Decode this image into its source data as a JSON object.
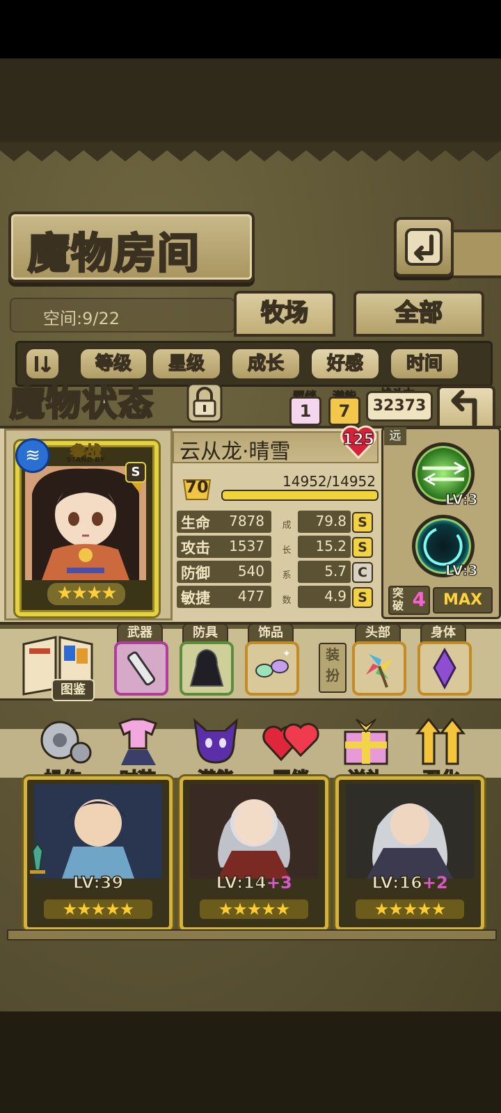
{
  "header": {
    "title": "魔物房间",
    "space_label": "空间:9/22",
    "tabs": [
      "牧场",
      "全部"
    ]
  },
  "sort": {
    "toggle_icon": "sort-toggle-icon",
    "options": [
      "等级",
      "星级",
      "成长",
      "好感",
      "时间"
    ],
    "selected": "好感"
  },
  "status": {
    "title": "魔物状态",
    "bond_label": "羁绊",
    "bond_value": "1",
    "potential_label": "潜能",
    "potential_value": "7",
    "power_label": "战斗力",
    "power_value": "32373",
    "stand_by": "参战",
    "stand_by_sub": "STAND BY",
    "rank_badge": "S",
    "stars": "★★★★",
    "name": "云从龙·晴雪",
    "affection": "125",
    "level": "70",
    "exp": "14952/14952",
    "exp_fraction": 1.0,
    "stats": [
      {
        "label": "生命",
        "value": "7878",
        "growth": "79.8",
        "grade": "S"
      },
      {
        "label": "攻击",
        "value": "1537",
        "growth": "15.2",
        "grade": "S"
      },
      {
        "label": "防御",
        "value": "540",
        "growth": "5.7",
        "grade": "C"
      },
      {
        "label": "敏捷",
        "value": "477",
        "growth": "4.9",
        "grade": "S"
      }
    ],
    "growth_chars": [
      "成",
      "长",
      "系",
      "数"
    ],
    "range": "远",
    "skills": [
      {
        "level": "LV:3"
      },
      {
        "level": "LV:3"
      }
    ],
    "breakthrough_label": "突破",
    "breakthrough_value": "4",
    "max_label": "MAX"
  },
  "equipment": {
    "book_label": "图鉴",
    "dress_label": "装扮",
    "slots": [
      {
        "label": "武器",
        "icon": "hair-clipper-icon"
      },
      {
        "label": "防具",
        "icon": "hooded-cloak-icon"
      },
      {
        "label": "饰品",
        "icon": "sparkle-mask-icon"
      },
      {
        "label": "头部",
        "icon": "pinwheel-icon"
      },
      {
        "label": "身体",
        "icon": "crystal-icon"
      }
    ]
  },
  "actions": [
    "操作",
    "时装",
    "潜能",
    "羁绊",
    "送礼",
    "强化"
  ],
  "cards": [
    {
      "level": "LV:39",
      "plus": "",
      "stars": "★★★★★"
    },
    {
      "level": "LV:14",
      "plus": "+3",
      "stars": "★★★★★"
    },
    {
      "level": "LV:16",
      "plus": "+2",
      "stars": "★★★★★"
    }
  ]
}
